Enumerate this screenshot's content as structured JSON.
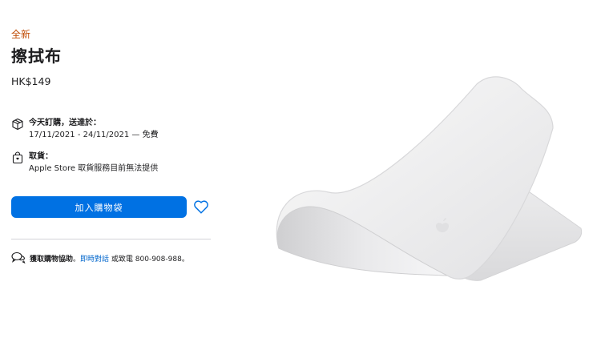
{
  "product": {
    "badge": "全新",
    "title": "擦拭布",
    "price": "HK$149"
  },
  "delivery": {
    "label": "今天訂購，送達於：",
    "detail": "17/11/2021 - 24/11/2021 — 免費"
  },
  "pickup": {
    "label": "取貨：",
    "detail": "Apple Store 取貨服務目前無法提供"
  },
  "actions": {
    "add_to_bag": "加入購物袋"
  },
  "help": {
    "label": "獲取購物協助",
    "sep1": "。",
    "chat_link": "即時對話",
    "call_text": " 或致電 800-908-988",
    "sep2": "。"
  },
  "colors": {
    "accent": "#0071e3",
    "badge_new": "#bf4800",
    "link": "#0066cc"
  }
}
